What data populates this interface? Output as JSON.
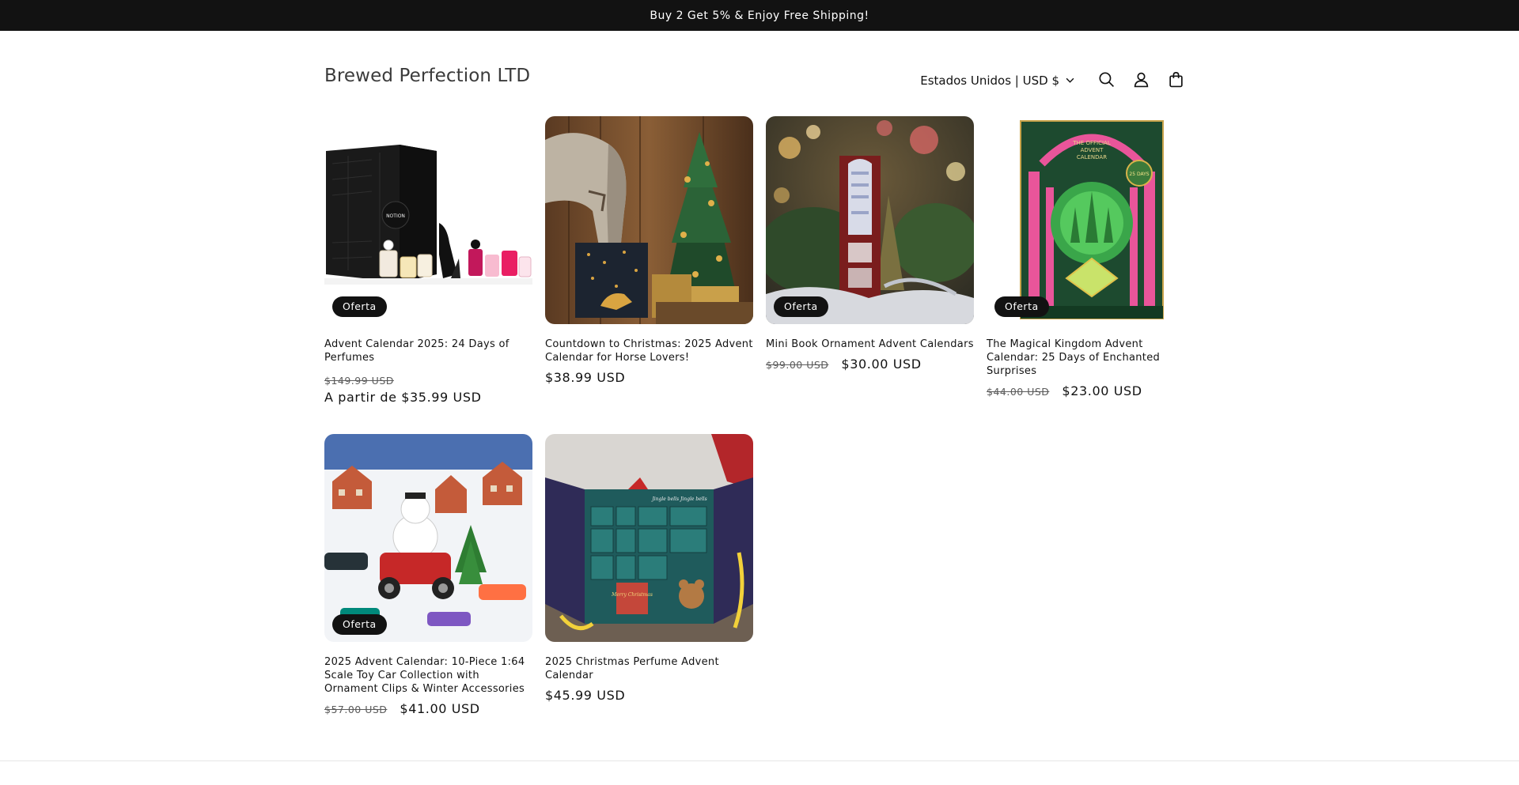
{
  "announcement": {
    "text": "Buy 2 Get 5% & Enjoy Free Shipping!"
  },
  "header": {
    "brand": "Brewed Perfection LTD",
    "locale": "Estados Unidos | USD $"
  },
  "products": [
    {
      "title": "Advent Calendar 2025: 24 Days of Perfumes",
      "badge": "Oferta",
      "compare_price": "$149.99 USD",
      "price": "A partir de $35.99 USD"
    },
    {
      "title": "Countdown to Christmas:   2025 Advent Calendar for Horse Lovers!",
      "badge": "",
      "compare_price": "",
      "price": "$38.99 USD"
    },
    {
      "title": "Mini Book Ornament Advent Calendars",
      "badge": "Oferta",
      "compare_price": "$99.00 USD",
      "price": "$30.00 USD"
    },
    {
      "title": "The Magical Kingdom Advent Calendar: 25 Days of Enchanted Surprises",
      "badge": "Oferta",
      "compare_price": "$44.00 USD",
      "price": "$23.00 USD"
    },
    {
      "title": "2025 Advent Calendar: 10-Piece 1:64 Scale Toy Car Collection with Ornament Clips & Winter Accessories",
      "badge": "Oferta",
      "compare_price": "$57.00 USD",
      "price": "$41.00 USD"
    },
    {
      "title": "2025 Christmas Perfume Advent Calendar",
      "badge": "",
      "compare_price": "",
      "price": "$45.99 USD"
    }
  ],
  "image_text": {
    "perfume_box": "NOTION",
    "kingdom_line1": "THE OFFICIAL",
    "kingdom_line2": "ADVENT",
    "kingdom_line3": "CALENDAR",
    "kingdom_seal": "25 DAYS",
    "perfume_calendar_script": "Jingle bells Jingle bells",
    "perfume_calendar_merry": "Merry Christmas"
  }
}
